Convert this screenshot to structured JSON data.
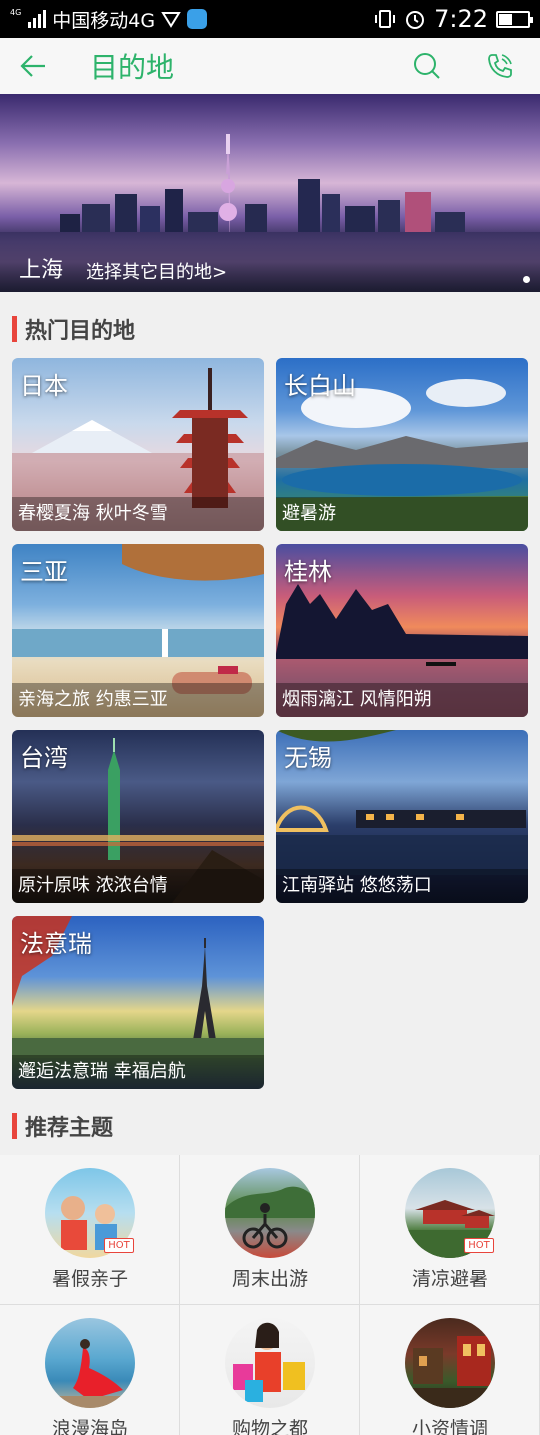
{
  "status_bar": {
    "carrier": "中国移动4G",
    "network_tag": "4G",
    "time": "7:22",
    "battery_level": 0.45
  },
  "header": {
    "title": "目的地",
    "accent_color": "#2db36b"
  },
  "hero": {
    "city": "上海",
    "select_label": "选择其它目的地>"
  },
  "hot_section": {
    "title": "热门目的地",
    "bar_color": "#e8453c"
  },
  "destinations": [
    {
      "title": "日本",
      "subtitle": "春樱夏海 秋叶冬雪"
    },
    {
      "title": "长白山",
      "subtitle": "避暑游"
    },
    {
      "title": "三亚",
      "subtitle": "亲海之旅 约惠三亚"
    },
    {
      "title": "桂林",
      "subtitle": "烟雨漓江 风情阳朔"
    },
    {
      "title": "台湾",
      "subtitle": "原汁原味 浓浓台情"
    },
    {
      "title": "无锡",
      "subtitle": "江南驿站 悠悠荡口"
    },
    {
      "title": "法意瑞",
      "subtitle": "邂逅法意瑞 幸福启航"
    }
  ],
  "theme_section": {
    "title": "推荐主题"
  },
  "themes": [
    {
      "label": "暑假亲子",
      "badge": "HOT",
      "icon": "family-beach-icon"
    },
    {
      "label": "周末出游",
      "icon": "cyclist-icon"
    },
    {
      "label": "清凉避暑",
      "badge": "HOT",
      "icon": "pagoda-icon"
    },
    {
      "label": "浪漫海岛",
      "icon": "island-icon"
    },
    {
      "label": "购物之都",
      "icon": "shopping-icon"
    },
    {
      "label": "小资情调",
      "icon": "cafe-icon"
    }
  ]
}
